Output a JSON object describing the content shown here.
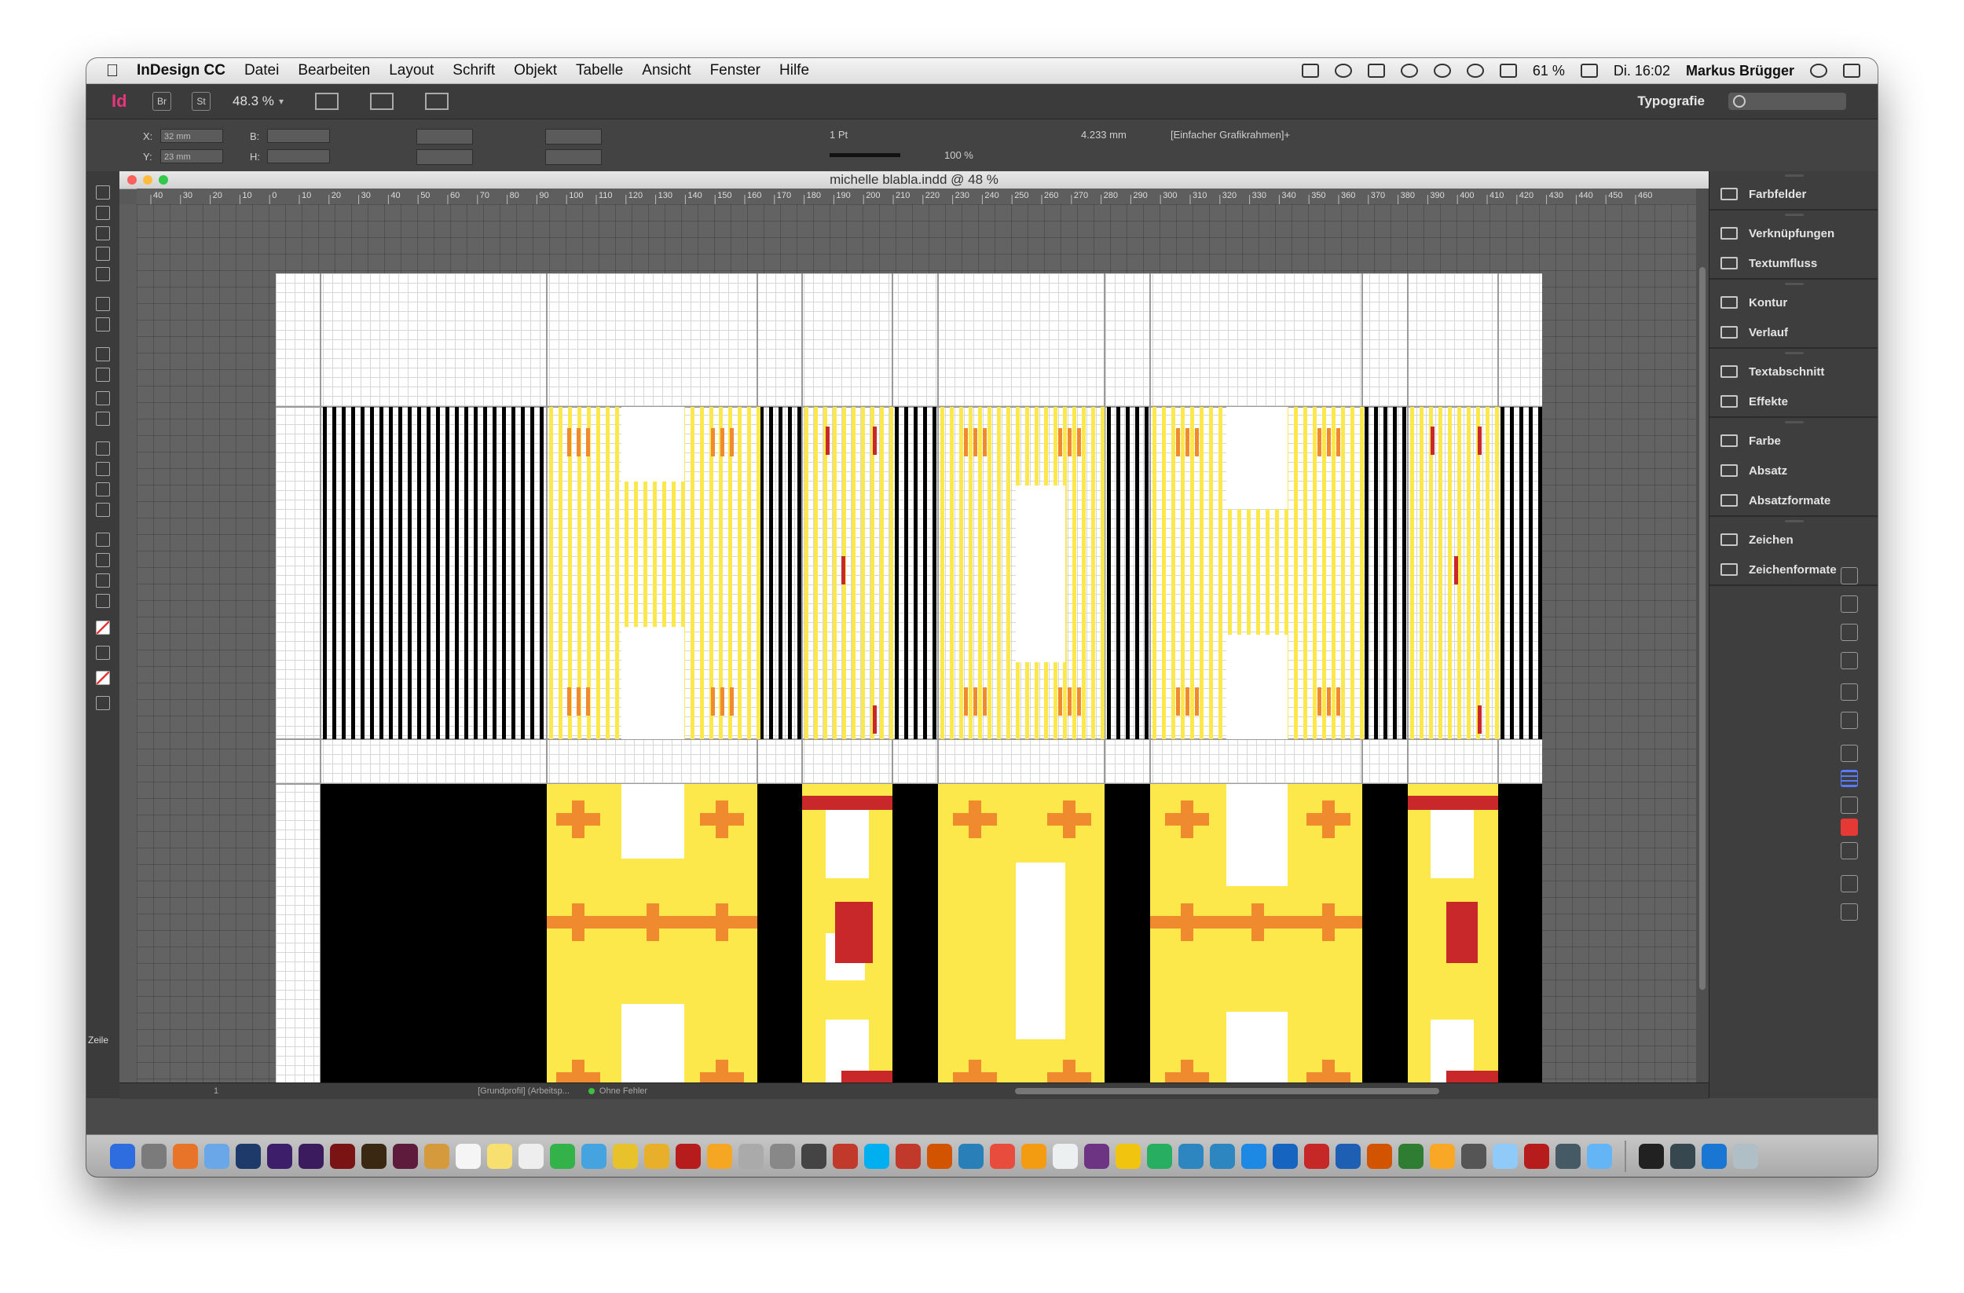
{
  "menubar": {
    "app_name": "InDesign CC",
    "items": [
      "Datei",
      "Bearbeiten",
      "Layout",
      "Schrift",
      "Objekt",
      "Tabelle",
      "Ansicht",
      "Fenster",
      "Hilfe"
    ],
    "battery": "61 %",
    "clock": "Di. 16:02",
    "user": "Markus Brügger"
  },
  "appbar": {
    "zoom": "48.3 %",
    "workspace": "Typografie"
  },
  "control": {
    "x_label": "X:",
    "y_label": "Y:",
    "w_label": "B:",
    "h_label": "H:",
    "x_value": "32 mm",
    "y_value": "23 mm",
    "stroke_weight": "1 Pt",
    "scale": "100 %",
    "size_mm": "4.233 mm",
    "object_style": "[Einfacher Grafikrahmen]+"
  },
  "document": {
    "title": "michelle blabla.indd @ 48 %",
    "ruler_marks": [
      "40",
      "30",
      "20",
      "10",
      "0",
      "10",
      "20",
      "30",
      "40",
      "50",
      "60",
      "70",
      "80",
      "90",
      "100",
      "110",
      "120",
      "130",
      "140",
      "150",
      "160",
      "170",
      "180",
      "190",
      "200",
      "210",
      "220",
      "230",
      "240",
      "250",
      "260",
      "270",
      "280",
      "290",
      "300",
      "310",
      "320",
      "330",
      "340",
      "350",
      "360",
      "370",
      "380",
      "390",
      "400",
      "410",
      "420",
      "430",
      "440",
      "450",
      "460"
    ],
    "preflight_profile": "[Grundprofil] (Arbeitsp...",
    "preflight_status": "Ohne Fehler",
    "page_number": "1"
  },
  "tools": {
    "zeile_label": "Zeile"
  },
  "panels": {
    "groups": [
      [
        "Farbfelder"
      ],
      [
        "Verknüpfungen",
        "Textumfluss"
      ],
      [
        "Kontur",
        "Verlauf"
      ],
      [
        "Textabschnitt",
        "Effekte"
      ],
      [
        "Farbe",
        "Absatz",
        "Absatzformate"
      ],
      [
        "Zeichen",
        "Zeichenformate"
      ]
    ]
  },
  "colors": {
    "yellow": "#fce84a",
    "orange": "#ef8a2e",
    "red": "#c8282a",
    "black": "#000000",
    "grid": "#d6d6d6"
  },
  "dock": {
    "apps": [
      "Finder",
      "Launchpad",
      "Firefox",
      "Preview",
      "Ps",
      "Ae",
      "Pr",
      "Fl",
      "Ai",
      "Id",
      "iBooks",
      "Calendar",
      "Notes",
      "Photos",
      "Messages",
      "Maps",
      "Chrome",
      "Cyberduck",
      "FileZilla",
      "Tweetbot",
      "Preview2",
      "Chess",
      "Aperture",
      "SelfControl",
      "Skype",
      "Scrivener",
      "Transmit",
      "Keynote",
      "iTunes",
      "Pages",
      "Reminders",
      "iMovie",
      "Stickies",
      "Numbers",
      "iPhoto",
      "Safari",
      "App Store",
      "Mail",
      "Acrobat",
      "Word",
      "PowerPoint",
      "Excel",
      "Oxygen",
      "Alfred",
      "iCloud",
      "Adobe Reader",
      "QuickTime",
      "Folder",
      "Terminal",
      "Monitor",
      "Downloads",
      "Trash"
    ]
  }
}
